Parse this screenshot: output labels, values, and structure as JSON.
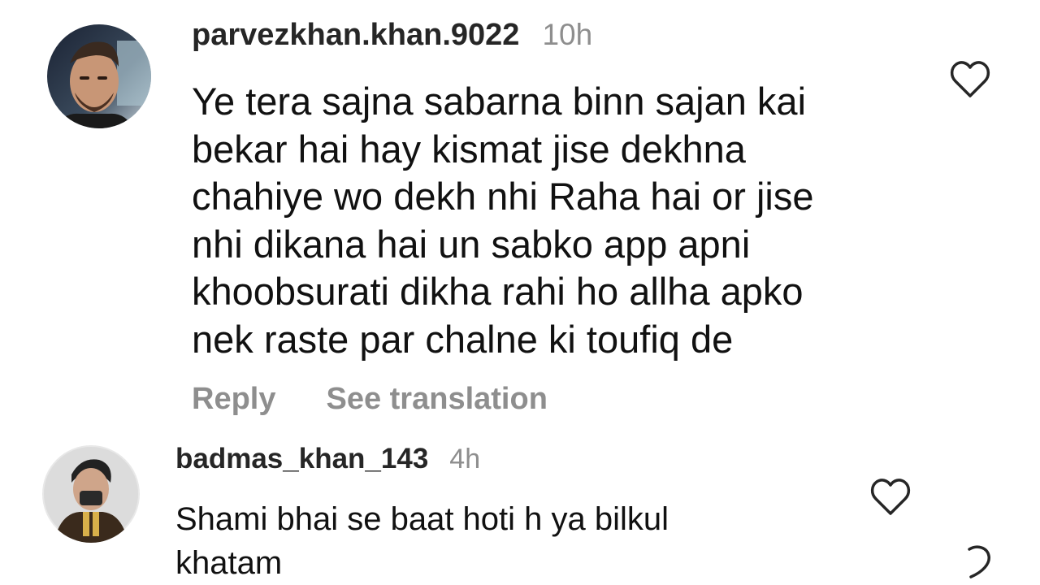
{
  "comments": [
    {
      "username": "parvezkhan.khan.9022",
      "time": "10h",
      "lines": [
        "Ye tera sajna sabarna binn sajan kai",
        "bekar hai hay kismat jise dekhna",
        "chahiye wo dekh nhi Raha hai or jise",
        "nhi dikana hai un sabko app apni",
        "khoobsurati dikha rahi ho allha apko",
        "nek raste par chalne ki toufiq de"
      ],
      "reply_label": "Reply",
      "translation_label": "See translation",
      "like_icon": "heart-outline-icon"
    },
    {
      "username": "badmas_khan_143",
      "time": "4h",
      "lines": [
        "Shami bhai se baat hoti h ya bilkul",
        "khatam"
      ],
      "like_icon": "heart-outline-icon"
    }
  ],
  "colors": {
    "username": "#262626",
    "secondary": "#8e8e8e",
    "text": "#111111",
    "background": "#ffffff"
  }
}
